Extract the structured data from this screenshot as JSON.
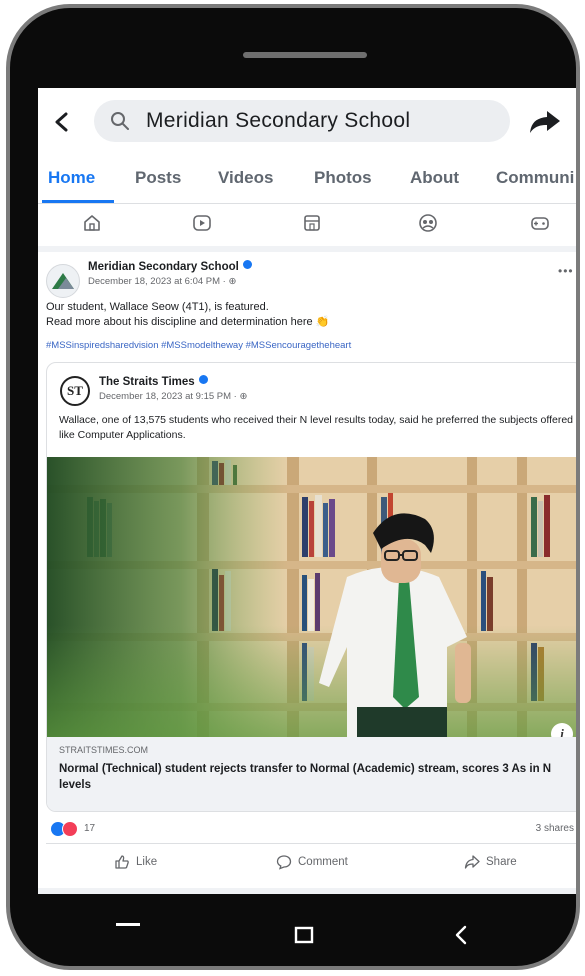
{
  "search": {
    "query": "Meridian Secondary School"
  },
  "tabs": [
    {
      "label": "Home"
    },
    {
      "label": "Posts"
    },
    {
      "label": "Videos"
    },
    {
      "label": "Photos"
    },
    {
      "label": "About"
    },
    {
      "label": "Communi"
    }
  ],
  "icon_row": [
    "home-icon",
    "video-icon",
    "shop-icon",
    "groups-icon",
    "gaming-icon"
  ],
  "post": {
    "page_name": "Meridian Secondary School",
    "time": "December 18, 2023 at 6:04 PM · ⊕",
    "text_line1": "Our student, Wallace Seow (4T1), is featured.",
    "text_line2": "Read more about his discipline and determination here 👏",
    "hashtags": "#MSSinspiredsharedvision #MSSmodeltheway #MSSencouragetheheart",
    "shared": {
      "source_name": "The Straits Times",
      "source_logo": "ST",
      "time": "December 18, 2023 at 9:15 PM · ⊕",
      "text": "Wallace, one of 13,575 students who received their N level results today, said he preferred the subjects offered like Computer Applications.",
      "link_domain": "STRAITSTIMES.COM",
      "link_title": "Normal (Technical) student rejects transfer to Normal (Academic) stream, scores 3 As in N levels"
    },
    "reactions": {
      "count": "17",
      "shares": "3 shares"
    },
    "actions": {
      "like": "Like",
      "comment": "Comment",
      "share": "Share"
    }
  },
  "colors": {
    "accent": "#1877f2",
    "tie": "#2f8a4a",
    "shelf": "#d9b98d"
  }
}
